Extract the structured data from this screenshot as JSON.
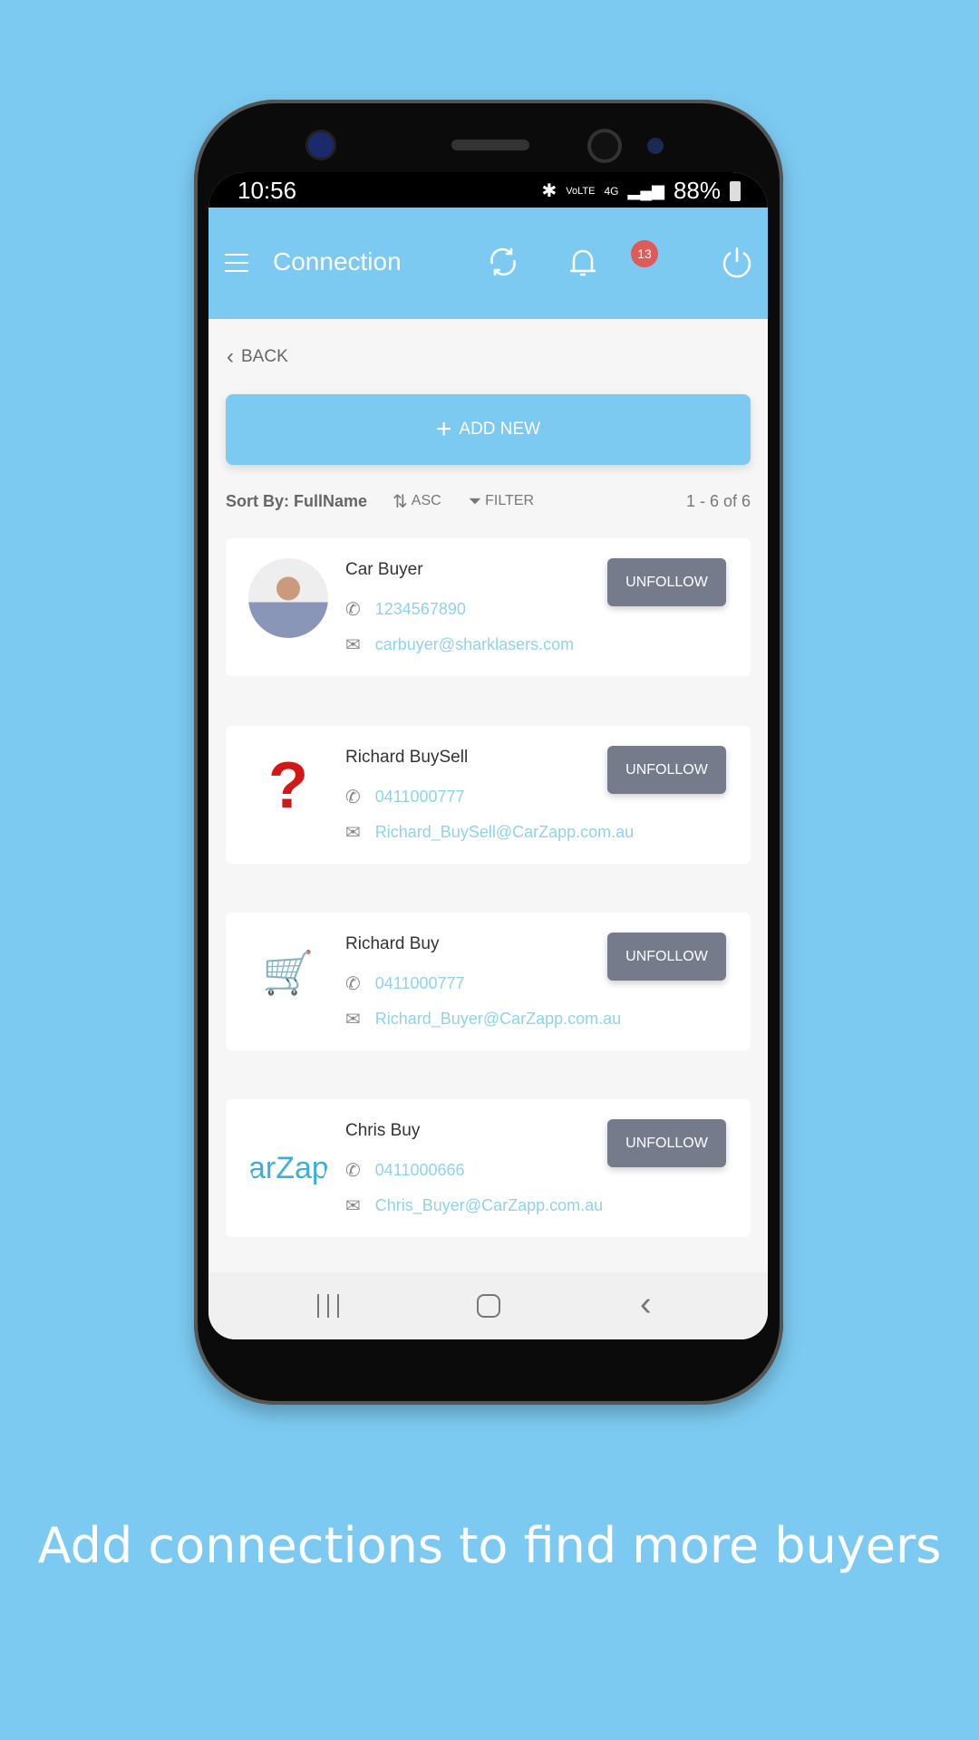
{
  "status": {
    "time": "10:56",
    "battery": "88%",
    "network": "4G",
    "volte": "VoLTE"
  },
  "header": {
    "title": "Connection",
    "notification_count": "13"
  },
  "back_label": "BACK",
  "add_new_label": "ADD NEW",
  "sort": {
    "label": "Sort By: FullName",
    "order": "ASC",
    "filter": "FILTER",
    "count": "1 - 6 of 6"
  },
  "connections": [
    {
      "name": "Car Buyer",
      "phone": "1234567890",
      "email": "carbuyer@sharklasers.com",
      "action": "UNFOLLOW",
      "avatar": "photo"
    },
    {
      "name": "Richard BuySell",
      "phone": "0411000777",
      "email": "Richard_BuySell@CarZapp.com.au",
      "action": "UNFOLLOW",
      "avatar": "question-mark"
    },
    {
      "name": "Richard Buy",
      "phone": "0411000777",
      "email": "Richard_Buyer@CarZapp.com.au",
      "action": "UNFOLLOW",
      "avatar": "shopping-cart-figure"
    },
    {
      "name": "Chris Buy",
      "phone": "0411000666",
      "email": "Chris_Buyer@CarZapp.com.au",
      "action": "UNFOLLOW",
      "avatar": "carzapp-logo"
    }
  ],
  "logo_text": "arZap",
  "caption": "Add connections to find more buyers",
  "colors": {
    "accent": "#7ccaf1",
    "button": "#767b8c",
    "badge": "#e05a5a",
    "link": "#8fd3ea"
  }
}
